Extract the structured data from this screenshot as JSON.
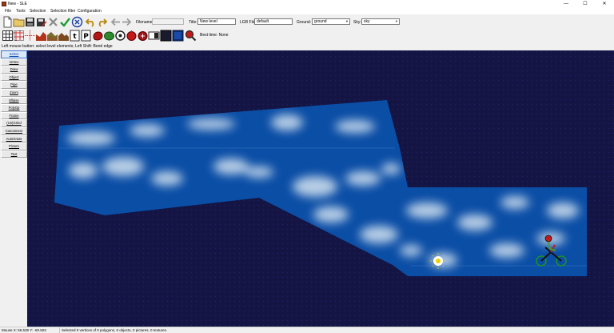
{
  "window": {
    "title": "New - SLE",
    "minimize": "—",
    "maximize": "☐",
    "close": "✕"
  },
  "menu": [
    "File",
    "Tools",
    "Selection",
    "Selection filter",
    "Configuration"
  ],
  "toolbar": {
    "filename_label": "Filename:",
    "filename_value": "",
    "title_label": "Title:",
    "title_value": "New level",
    "lgr_label": "LGR File:",
    "lgr_value": "default",
    "ground_label": "Ground:",
    "ground_value": "ground",
    "sky_label": "Sky:",
    "sky_value": "sky",
    "best_time": "Best time: None",
    "row1_icons": [
      "new-file-icon",
      "open-folder-icon",
      "save-icon",
      "save-as-icon",
      "delete-icon",
      "check-topology-icon",
      "play-level-icon",
      "undo-icon",
      "redo-icon",
      "arrow-left-icon",
      "arrow-right-icon"
    ],
    "row2_icons": [
      "grid-icon",
      "grid-snap-icon",
      "crosshair-icon",
      "ground-texture-icon",
      "texture-icon",
      "picture-icon",
      "text-icon",
      "p-icon",
      "killer-icon",
      "bush-icon",
      "flower-icon",
      "apple-icon",
      "red-apple-icon",
      "bike-start-icon",
      "black-square-icon",
      "dark-square-icon",
      "zoom-fill-icon",
      "search-icon"
    ]
  },
  "hint": "Left mouse button: select level elements; Left Shift: Bend edge",
  "modes": {
    "active": "Select",
    "items": [
      "Select",
      "Vertex",
      "Draw",
      "Object",
      "Pipe",
      "Zoom",
      "Ellipse",
      "PolyOp",
      "Frame",
      "(Un)Grind",
      "Cutconnect",
      "AutoGrass",
      "Picture",
      "Text"
    ]
  },
  "colors": {
    "sky": "#141544",
    "ground_dark": "#0b4ea6",
    "ground_light": "#d6e4f1",
    "accent": "#3a73c8"
  },
  "status": {
    "mouse": "Mouse X: 56.539 Y: -60.503",
    "selection": "Selected 0 vertices of 0 polygons, 0 objects, 0 pictures, 0 textures."
  }
}
